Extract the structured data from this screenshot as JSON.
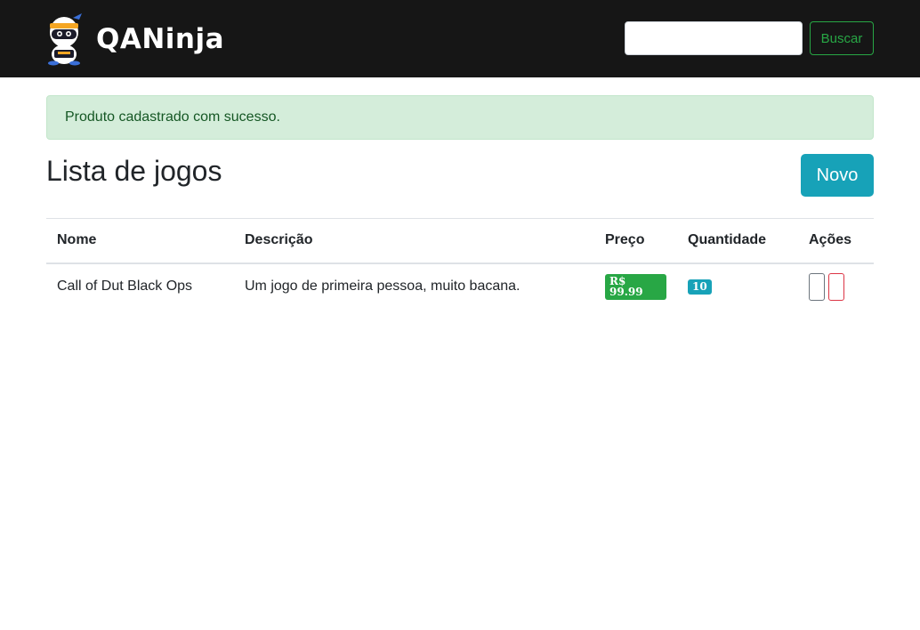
{
  "navbar": {
    "brand_text": "QANinja",
    "search": {
      "value": "",
      "placeholder": ""
    },
    "search_button_label": "Buscar"
  },
  "alert": {
    "message": "Produto cadastrado com sucesso."
  },
  "page": {
    "title": "Lista de jogos",
    "new_button_label": "Novo"
  },
  "table": {
    "headers": {
      "nome": "Nome",
      "descricao": "Descrição",
      "preco": "Preço",
      "quantidade": "Quantidade",
      "acoes": "Ações"
    },
    "rows": [
      {
        "nome": "Call of Dut Black Ops",
        "descricao": "Um jogo de primeira pessoa, muito bacana.",
        "preco": "R$ 99.99",
        "quantidade": "10"
      }
    ]
  },
  "colors": {
    "navbar_bg": "#161616",
    "success": "#28a745",
    "info": "#17a2b8",
    "danger": "#dc3545",
    "alert_bg": "#d4edda"
  }
}
